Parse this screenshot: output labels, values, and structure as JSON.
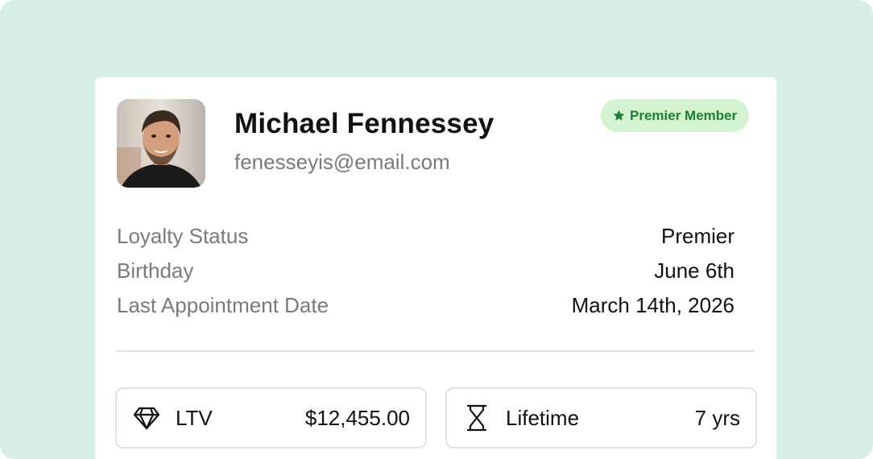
{
  "profile": {
    "name": "Michael Fennessey",
    "email": "fenesseyis@email.com",
    "badge": {
      "label": "Premier Member",
      "icon": "star-icon",
      "color": "#1e7f2e",
      "background": "#d3f3d3"
    }
  },
  "details": [
    {
      "label": "Loyalty Status",
      "value": "Premier"
    },
    {
      "label": "Birthday",
      "value": "June 6th"
    },
    {
      "label": "Last Appointment Date",
      "value": "March 14th, 2026"
    }
  ],
  "stats": [
    {
      "label": "LTV",
      "value": "$12,455.00",
      "icon": "diamond-icon"
    },
    {
      "label": "Lifetime",
      "value": "7 yrs",
      "icon": "hourglass-icon"
    }
  ],
  "colors": {
    "page_background": "#d6f0e5",
    "card_background": "#ffffff",
    "muted_text": "#7a7a7a",
    "primary_text": "#111111"
  }
}
